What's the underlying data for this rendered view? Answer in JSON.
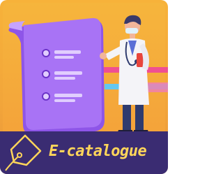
{
  "tile": {
    "label": "E-catalogue",
    "icon": "tag-icon",
    "illustration": "doctor-with-document",
    "colors": {
      "background": "#f6b03b",
      "banner": "#3a2c72",
      "label": "#ffd65a",
      "document": "#a36cf2",
      "stripe_pink": "#ef4f92",
      "stripe_blue": "#63c7f0"
    }
  }
}
